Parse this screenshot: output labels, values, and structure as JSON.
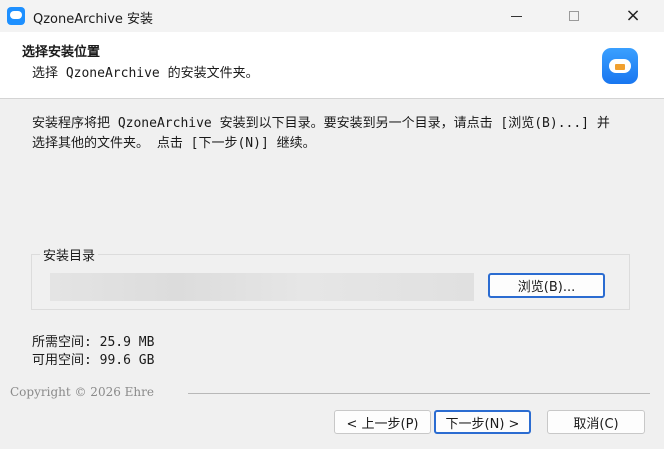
{
  "window": {
    "title": "QzoneArchive 安装",
    "app_icon": "cloud-app-icon",
    "controls": {
      "minimize": "minimize-icon",
      "maximize": "maximize-icon",
      "close": "×"
    }
  },
  "header": {
    "title": "选择安装位置",
    "subtitle": "选择 QzoneArchive 的安装文件夹。",
    "icon": "cloud-archive-icon"
  },
  "body": {
    "description": "安装程序将把 QzoneArchive 安装到以下目录。要安装到另一个目录，请点击 [浏览(B)...] 并选择其他的文件夹。 点击 [下一步(N)] 继续。"
  },
  "install_dir": {
    "group_label": "安装目录",
    "path_value": "",
    "browse_label": "浏览(B)..."
  },
  "space": {
    "required": "所需空间: 25.9 MB",
    "available": "可用空间: 99.6 GB"
  },
  "footer": {
    "brand": "Copyright © 2026 Ehre",
    "back_label": "< 上一步(P)",
    "next_label": "下一步(N) >",
    "cancel_label": "取消(C)"
  },
  "colors": {
    "accent": "#2b6cd1",
    "background": "#f0f0f0",
    "header_bg": "#ffffff"
  }
}
